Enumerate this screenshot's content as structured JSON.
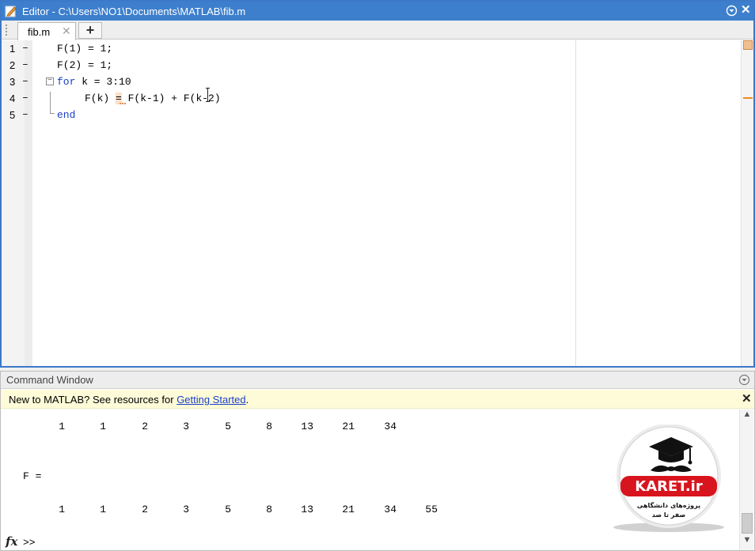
{
  "editor": {
    "title": "Editor - C:\\Users\\NO1\\Documents\\MATLAB\\fib.m",
    "tab_label": "fib.m",
    "tab_close": "✕",
    "new_tab": "+",
    "close_glyph": "✕",
    "lines": [
      {
        "num": "1",
        "dash": "–",
        "code": "F(1) = 1;"
      },
      {
        "num": "2",
        "dash": "–",
        "code": "F(2) = 1;"
      },
      {
        "num": "3",
        "dash": "–",
        "kw": "for",
        "code": " k = 3:10"
      },
      {
        "num": "4",
        "dash": "–",
        "pre": "F(k) ",
        "hl": "=",
        "post": " F(k-1) + F(k-2)"
      },
      {
        "num": "5",
        "dash": "–",
        "kw": "end"
      }
    ]
  },
  "command_window": {
    "title": "Command Window",
    "notice_text": "New to MATLAB? See resources for ",
    "notice_link": "Getting Started",
    "notice_end": ".",
    "notice_close": "✕",
    "row1": [
      "1",
      "1",
      "2",
      "3",
      "5",
      "8",
      "13",
      "21",
      "34"
    ],
    "var_label": "F =",
    "row2": [
      "1",
      "1",
      "2",
      "3",
      "5",
      "8",
      "13",
      "21",
      "34",
      "55"
    ],
    "fx": "fx",
    "prompt": ">>"
  },
  "watermark": {
    "brand": "KARET.ir",
    "line1": "پروژه‌های دانشگاهی",
    "line2": "صفر تا صد"
  },
  "colors": {
    "title_bar": "#3d7fcc",
    "keyword": "#1c3fc8",
    "notice_bg": "#fefbd8",
    "logo_red": "#d8141e"
  }
}
